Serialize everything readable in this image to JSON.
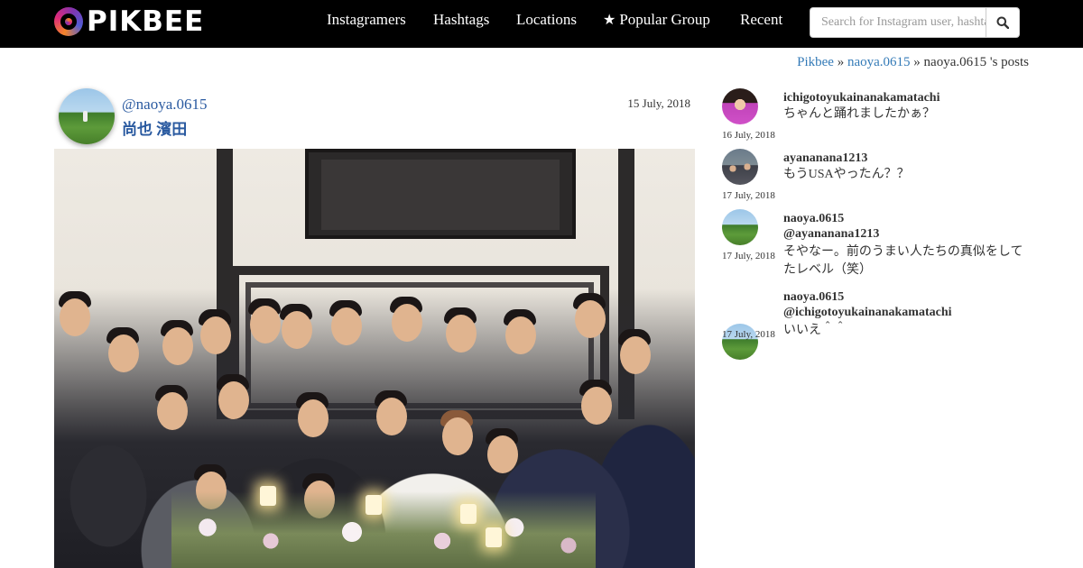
{
  "brand": {
    "name": "PIKBEE"
  },
  "nav": {
    "items": [
      {
        "label": "Instagramers"
      },
      {
        "label": "Hashtags"
      },
      {
        "label": "Locations"
      },
      {
        "label": "Popular Group",
        "icon": "star-icon"
      },
      {
        "label": "Recent"
      }
    ],
    "search_placeholder": "Search for Instagram user, hashtag"
  },
  "breadcrumb": {
    "home": "Pikbee",
    "sep1": "»",
    "user": "naoya.0615",
    "sep2": "»",
    "current": "naoya.0615 's posts"
  },
  "post": {
    "username": "@naoya.0615",
    "full_name": "尚也 濱田",
    "date": "15 July, 2018"
  },
  "comments": [
    {
      "user": "ichigotoyukainanakamatachi",
      "text": "ちゃんと踊れましたかぁ？",
      "date": "16 July, 2018",
      "avatar": "woman"
    },
    {
      "user": "ayananana1213",
      "text": "もうUSAやったん？？",
      "date": "17 July, 2018",
      "avatar": "crowd"
    },
    {
      "user": "naoya.0615",
      "mention": "@ayananana1213",
      "text": "そやなー。前のうまい人たちの真似をしてたレベル（笑）",
      "date": "17 July, 2018",
      "avatar": "golf"
    },
    {
      "user": "naoya.0615",
      "mention": "@ichigotoyukainanakamatachi",
      "text": "いいえ＾＾",
      "date": "17 July, 2018",
      "avatar": "golf"
    }
  ],
  "colors": {
    "navbar_bg": "#000000",
    "link": "#337ab7",
    "username": "#2a5aa0"
  }
}
